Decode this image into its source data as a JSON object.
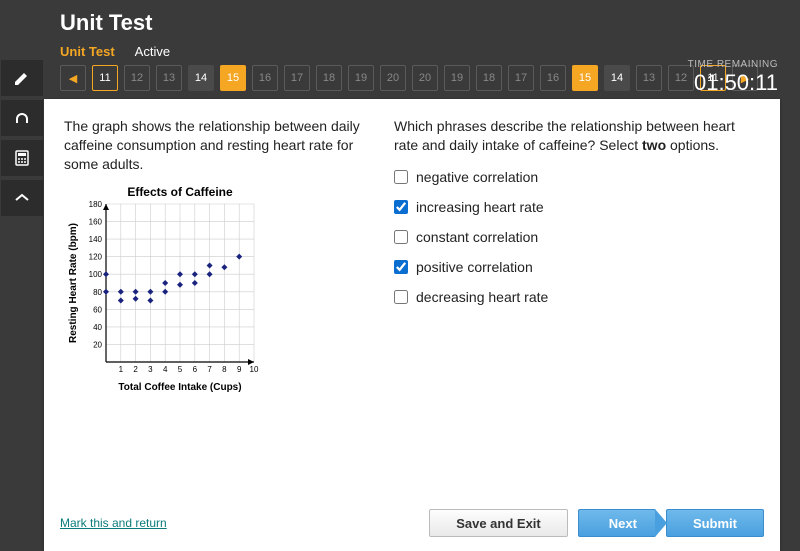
{
  "header": {
    "title": "Unit Test"
  },
  "subheader": {
    "unit": "Unit Test",
    "state": "Active"
  },
  "nav": {
    "prev_icon": "◀",
    "next_icon": "▶",
    "pages": [
      {
        "n": "11",
        "cls": "cur"
      },
      {
        "n": "12",
        "cls": ""
      },
      {
        "n": "13",
        "cls": ""
      },
      {
        "n": "14",
        "cls": "done"
      },
      {
        "n": "15",
        "cls": "active"
      },
      {
        "n": "16",
        "cls": ""
      },
      {
        "n": "17",
        "cls": ""
      },
      {
        "n": "18",
        "cls": ""
      },
      {
        "n": "19",
        "cls": ""
      },
      {
        "n": "20",
        "cls": ""
      }
    ]
  },
  "timer": {
    "label": "TIME REMAINING",
    "value": "01:50:11"
  },
  "left": {
    "prompt": "The graph shows the relationship between daily caffeine consumption and resting heart rate for some adults."
  },
  "right": {
    "question_pre": "Which phrases describe the relationship between heart rate and daily intake of caffeine? Select ",
    "question_bold": "two",
    "question_post": " options.",
    "options": [
      {
        "label": "negative correlation",
        "checked": false
      },
      {
        "label": "increasing heart rate",
        "checked": true
      },
      {
        "label": "constant correlation",
        "checked": false
      },
      {
        "label": "positive correlation",
        "checked": true
      },
      {
        "label": "decreasing heart rate",
        "checked": false
      }
    ]
  },
  "footer": {
    "mark": "Mark this and return",
    "save": "Save and Exit",
    "next": "Next",
    "submit": "Submit"
  },
  "chart_data": {
    "type": "scatter",
    "title": "Effects of Caffeine",
    "xlabel": "Total Coffee Intake (Cups)",
    "ylabel": "Resting Heart Rate (bpm)",
    "xlim": [
      0,
      10
    ],
    "ylim": [
      0,
      180
    ],
    "xticks": [
      1,
      2,
      3,
      4,
      5,
      6,
      7,
      8,
      9,
      10
    ],
    "yticks": [
      20,
      40,
      60,
      80,
      100,
      120,
      140,
      160,
      180
    ],
    "points": [
      {
        "x": 0,
        "y": 80
      },
      {
        "x": 0,
        "y": 100
      },
      {
        "x": 1,
        "y": 70
      },
      {
        "x": 1,
        "y": 80
      },
      {
        "x": 2,
        "y": 80
      },
      {
        "x": 2,
        "y": 72
      },
      {
        "x": 3,
        "y": 70
      },
      {
        "x": 3,
        "y": 80
      },
      {
        "x": 4,
        "y": 80
      },
      {
        "x": 4,
        "y": 90
      },
      {
        "x": 5,
        "y": 100
      },
      {
        "x": 5,
        "y": 88
      },
      {
        "x": 6,
        "y": 100
      },
      {
        "x": 6,
        "y": 90
      },
      {
        "x": 7,
        "y": 100
      },
      {
        "x": 7,
        "y": 110
      },
      {
        "x": 8,
        "y": 108
      },
      {
        "x": 9,
        "y": 120
      }
    ]
  }
}
